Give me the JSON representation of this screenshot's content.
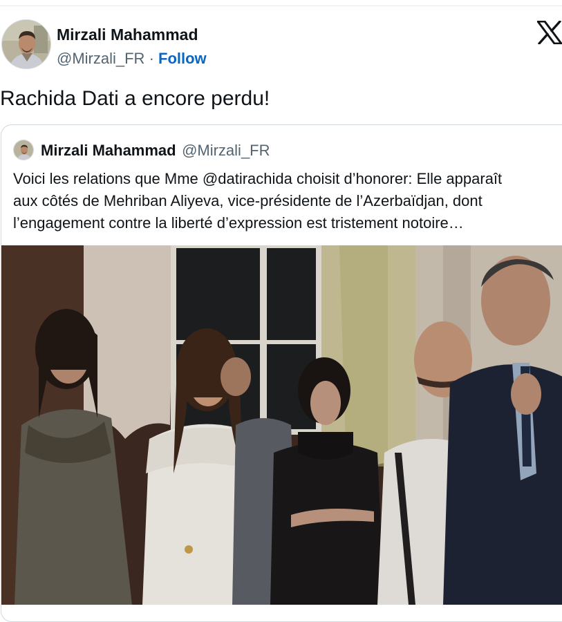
{
  "author": {
    "name": "Mirzali Mahammad",
    "handle": "@Mirzali_FR",
    "separator": " · ",
    "follow_label": "Follow"
  },
  "tweet": {
    "text": "Rachida Dati a encore perdu!"
  },
  "quoted": {
    "name": "Mirzali Mahammad",
    "handle": "@Mirzali_FR",
    "text_lines": [
      "Voici les relations que Mme @datirachida choisit d’honorer: Elle apparaît",
      "aux côtés de Mehriban Aliyeva, vice-présidente de l’Azerbaïdjan, dont",
      "l’engagement contre la liberté d’expression est tristement notoire…"
    ]
  },
  "icons": {
    "brand": "x-logo-icon",
    "avatar": "profile-photo",
    "photo": "event-photo"
  },
  "colors": {
    "text": "#0f1419",
    "secondary": "#536471",
    "follow": "#0a66c2",
    "border": "#cfd9de"
  }
}
